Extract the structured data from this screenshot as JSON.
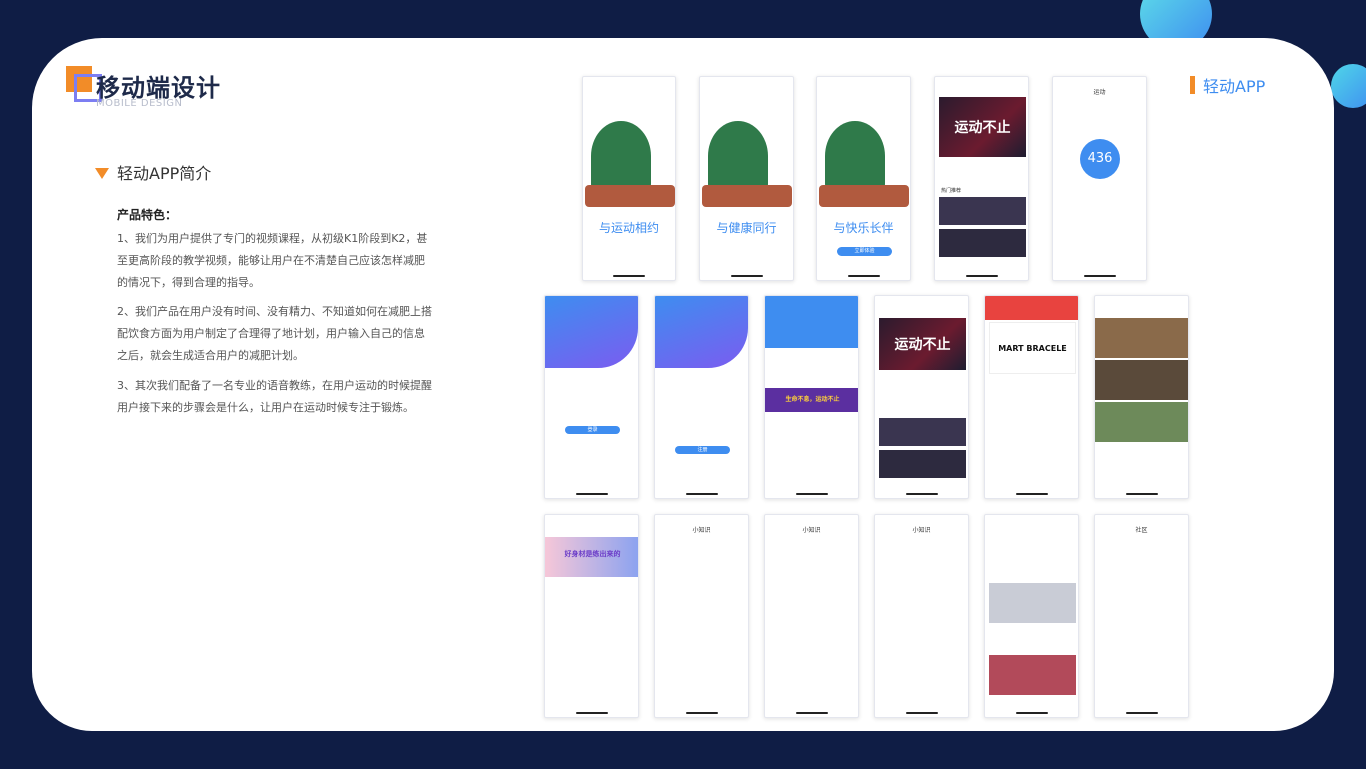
{
  "header": {
    "title": "移动端设计",
    "subtitle": "MOBILE DESIGN",
    "tag": "轻动APP"
  },
  "section": {
    "title": "轻动APP简介",
    "features_title": "产品特色：",
    "paragraphs": [
      "1、我们为用户提供了专门的视频课程，从初级K1阶段到K2，甚至更高阶段的教学视频，能够让用户在不清楚自己应该怎样减肥的情况下，得到合理的指导。",
      "2、我们产品在用户没有时间、没有精力、不知道如何在减肥上搭配饮食方面为用户制定了合理得了地计划，用户输入自己的信息之后，就会生成适合用户的减肥计划。",
      "3、其次我们配备了一名专业的语音教练，在用户运动的时候提醒用户接下来的步骤会是什么，让用户在运动时候专注于锻炼。"
    ]
  },
  "screens": {
    "onboard": [
      "与运动相约",
      "与健康同行",
      "与快乐长伴"
    ],
    "start_button": "立即体验",
    "banner": "运动不止",
    "banner2": "生命不息，运动不止",
    "stats_title": "运动",
    "stats_value": "436",
    "hot": "热门推荐",
    "login_button": "登录",
    "register_button": "注册",
    "headline": "好身材是练出来的",
    "knowledge": "小知识",
    "community": "社区",
    "cloth": "MART BRACELE",
    "colors": {
      "accent": "#3e8df0",
      "orange": "#f28c28",
      "navy": "#0f1d45"
    }
  }
}
